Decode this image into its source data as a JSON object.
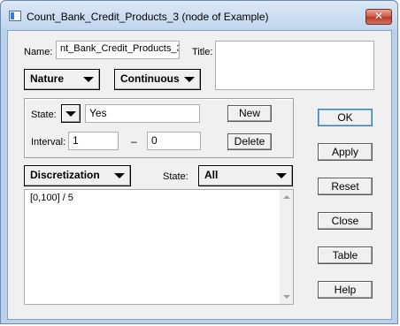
{
  "window": {
    "title": "Count_Bank_Credit_Products_3 (node of Example)",
    "close_glyph": "✕"
  },
  "node": {
    "name_label": "Name:",
    "name_value": "nt_Bank_Credit_Products_3",
    "title_label": "Title:",
    "title_value": ""
  },
  "nature_dropdown": {
    "label": "Nature"
  },
  "type_dropdown": {
    "label": "Continuous"
  },
  "state_group": {
    "state_label": "State:",
    "state_value": "Yes",
    "new_button": "New",
    "interval_label": "Interval:",
    "interval_low": "1",
    "interval_separator": "–",
    "interval_high": "0",
    "delete_button": "Delete"
  },
  "discretization": {
    "dropdown_label": "Discretization",
    "state_label": "State:",
    "state_select": "All",
    "text": "[0,100] / 5"
  },
  "side_buttons": {
    "ok": "OK",
    "apply": "Apply",
    "reset": "Reset",
    "close": "Close",
    "table": "Table",
    "help": "Help"
  },
  "icons": {
    "app_icon": "window-app-icon",
    "close_icon": "close-icon",
    "dropdown_icon": "chevron-down-icon"
  }
}
